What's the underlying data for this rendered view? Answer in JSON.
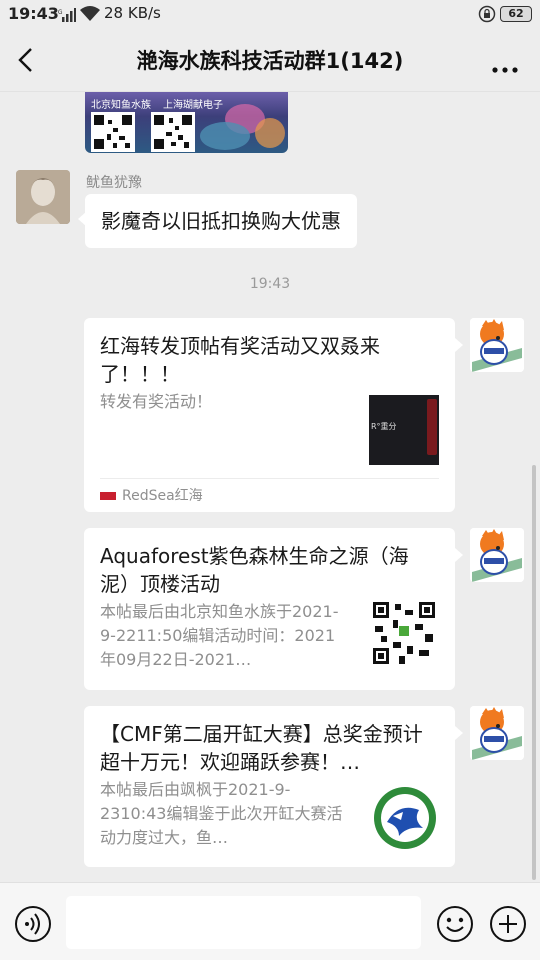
{
  "status_bar": {
    "time": "19:43",
    "network_speed": "28 KB/s",
    "battery": "62"
  },
  "header": {
    "title": "滟海水族科技活动群1(142)"
  },
  "image_message": {
    "captions": [
      "北京知鱼水族",
      "上海瑚献电子"
    ]
  },
  "friend_message": {
    "sender": "鱿鱼犹豫",
    "text": "影魔奇以旧抵扣换购大优惠"
  },
  "timestamp": "19:43",
  "cards": [
    {
      "title": "红海转发顶帖有奖活动又双叒来了！！！",
      "description": "转发有奖活动！",
      "thumb_text": "R°重分",
      "source": "RedSea红海"
    },
    {
      "title": "Aquaforest紫色森林生命之源（海泥）顶楼活动",
      "description": "本帖最后由北京知鱼水族于2021-9-2211:50编辑活动时间：2021年09月22日-2021…"
    },
    {
      "title": "【CMF第二届开缸大赛】总奖金预计超十万元！欢迎踊跃参赛！…",
      "description": "本帖最后由飒枫于2021-9-2310:43编辑鉴于此次开缸大赛活动力度过大，鱼…"
    }
  ],
  "input_bar": {
    "placeholder": ""
  },
  "colors": {
    "background": "#ededed",
    "bubble": "#ffffff",
    "secondary_text": "#8f8f8f"
  }
}
